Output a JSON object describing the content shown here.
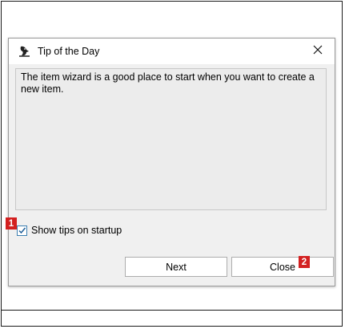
{
  "dialog": {
    "title": "Tip of the Day",
    "app_icon": "app-bird-icon",
    "close_icon": "close-icon",
    "tip_text": "The item wizard is a good place to start when you want to create a new item.",
    "checkbox": {
      "label": "Show tips on startup",
      "checked": true
    },
    "buttons": {
      "next_label": "Next",
      "close_label": "Close"
    }
  },
  "markers": {
    "first": "1",
    "second": "2"
  },
  "colors": {
    "marker": "#d32020",
    "checkbox_accent": "#3c7fb1"
  }
}
